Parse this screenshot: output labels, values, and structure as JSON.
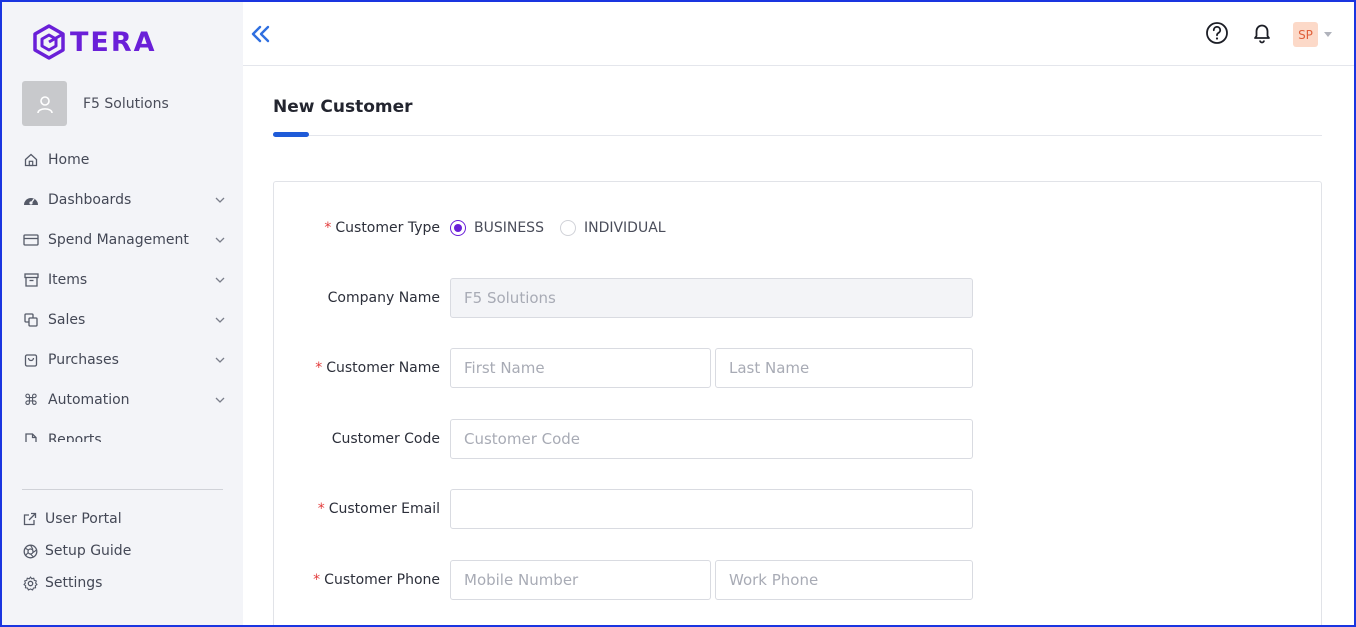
{
  "brand": {
    "name": "TERA",
    "color": "#6a1fd8"
  },
  "sidebar": {
    "org_name": "F5 Solutions",
    "items": [
      {
        "label": "Home",
        "icon": "home-icon",
        "expandable": false
      },
      {
        "label": "Dashboards",
        "icon": "dashboard-icon",
        "expandable": true
      },
      {
        "label": "Spend Management",
        "icon": "card-icon",
        "expandable": true
      },
      {
        "label": "Items",
        "icon": "archive-icon",
        "expandable": true
      },
      {
        "label": "Sales",
        "icon": "copy-icon",
        "expandable": true
      },
      {
        "label": "Purchases",
        "icon": "bag-icon",
        "expandable": true
      },
      {
        "label": "Automation",
        "icon": "command-icon",
        "expandable": true
      },
      {
        "label": "Reports",
        "icon": "file-icon",
        "expandable": false
      }
    ],
    "bottom_items": [
      {
        "label": "User Portal",
        "icon": "external-link-icon"
      },
      {
        "label": "Setup Guide",
        "icon": "aperture-icon"
      },
      {
        "label": "Settings",
        "icon": "gear-icon"
      }
    ]
  },
  "topbar": {
    "user_initials": "SP"
  },
  "page": {
    "title": "New Customer"
  },
  "form": {
    "customer_type": {
      "label": "Customer Type",
      "required": true,
      "options": [
        "BUSINESS",
        "INDIVIDUAL"
      ],
      "selected": "BUSINESS"
    },
    "company_name": {
      "label": "Company Name",
      "value": "F5 Solutions"
    },
    "customer_name": {
      "label": "Customer Name",
      "required": true,
      "first_placeholder": "First Name",
      "last_placeholder": "Last Name"
    },
    "customer_code": {
      "label": "Customer Code",
      "placeholder": "Customer Code"
    },
    "customer_email": {
      "label": "Customer Email",
      "required": true,
      "value": ""
    },
    "customer_phone": {
      "label": "Customer Phone",
      "required": true,
      "mobile_placeholder": "Mobile Number",
      "work_placeholder": "Work Phone"
    }
  },
  "colors": {
    "accent": "#1f5bd8",
    "required": "#e23b3b",
    "sidebar_bg": "#f3f4f8"
  }
}
